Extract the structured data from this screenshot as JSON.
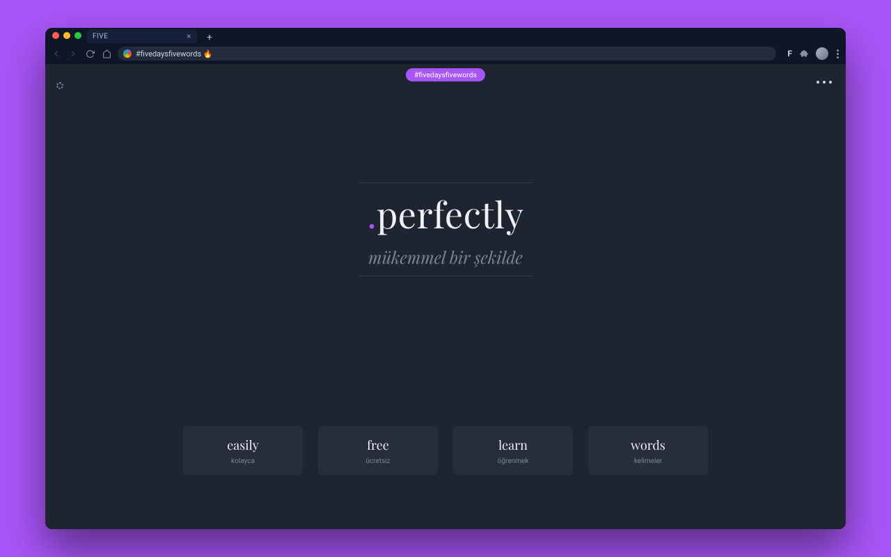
{
  "browser": {
    "tab_title": "FIVE",
    "url_display": "#fivedaysfivewords 🔥",
    "toolbar_right_label": "F"
  },
  "chip": {
    "label": "#fivedaysfivewords"
  },
  "hero": {
    "word": "perfectly",
    "translation": "mükemmel bir şekilde"
  },
  "cards": [
    {
      "en": "easily",
      "tr": "kolayca"
    },
    {
      "en": "free",
      "tr": "ücretsiz"
    },
    {
      "en": "learn",
      "tr": "öğrenmek"
    },
    {
      "en": "words",
      "tr": "kelimeler"
    }
  ],
  "colors": {
    "accent": "#a855f7",
    "page_bg": "#1e2430",
    "card_bg": "#272d3a"
  }
}
